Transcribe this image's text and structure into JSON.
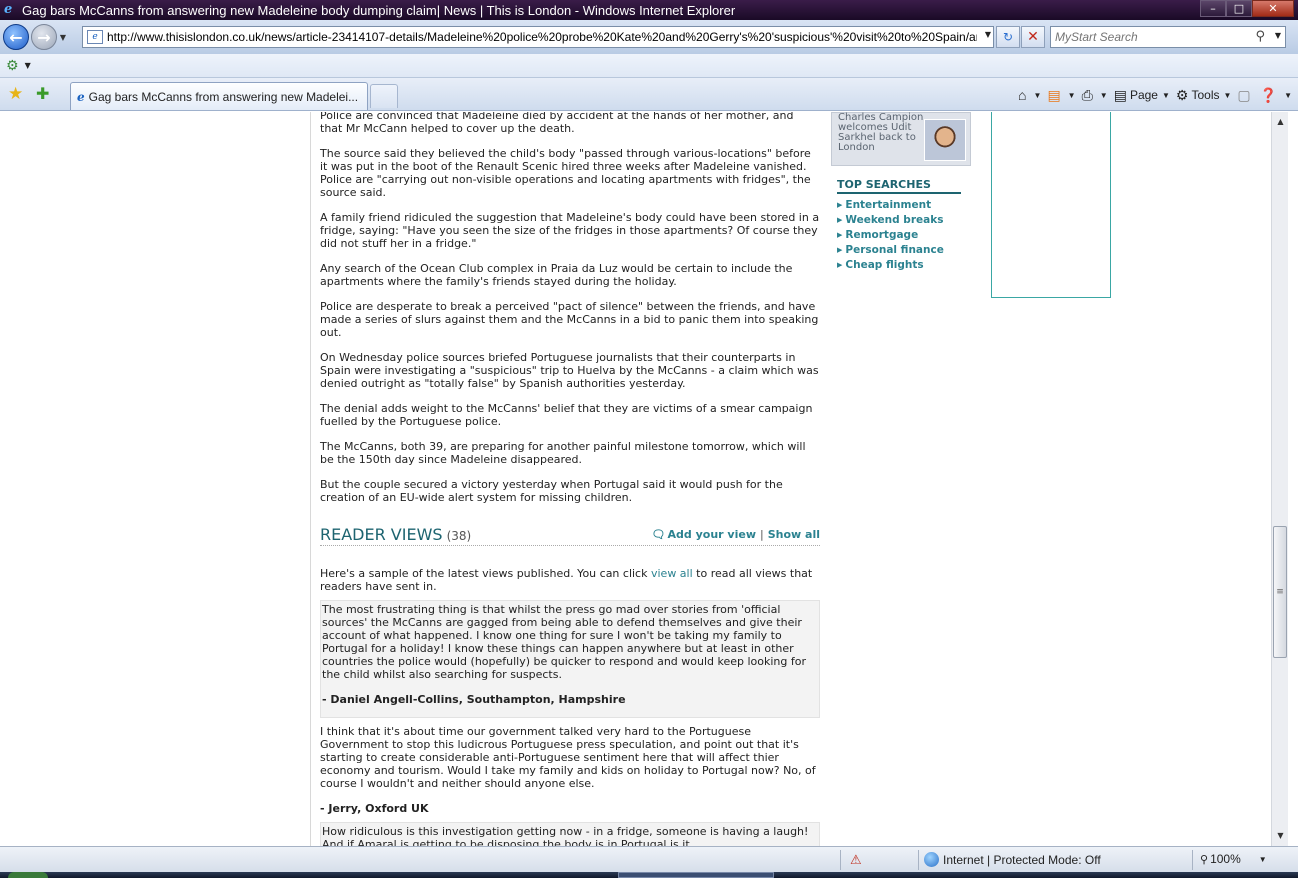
{
  "window": {
    "title": "Gag bars McCanns from answering new Madeleine body dumping claim| News | This is London - Windows Internet Explorer",
    "minimize": "–",
    "maximize": "□",
    "close": "✕"
  },
  "address": {
    "url": "http://www.thisislondon.co.uk/news/article-23414107-details/Madeleine%20police%20probe%20Kate%20and%20Gerry's%20'suspicious'%20visit%20to%20Spain/arti"
  },
  "search": {
    "placeholder": "MyStart Search"
  },
  "tabs": {
    "active_label": "Gag bars McCanns from answering new Madelei..."
  },
  "command_bar": {
    "page_label": "Page",
    "tools_label": "Tools"
  },
  "article": {
    "cut_line": "Police are convinced that Madeleine died by accident at the hands of her mother, and",
    "paragraphs": [
      "that Mr McCann helped to cover up the death.",
      "The source said they believed the child's body \"passed through various-locations\" before it was put in the boot of the Renault Scenic hired three weeks after Madeleine vanished. Police are \"carrying out non-visible operations and locating apartments with fridges\", the source said.",
      "A family friend ridiculed the suggestion that Madeleine's body could have been stored in a fridge, saying: \"Have you seen the size of the fridges in those apartments? Of course they did not stuff her in a fridge.\"",
      "Any search of the Ocean Club complex in Praia da Luz would be certain to include the apartments where the family's friends stayed during the holiday.",
      "Police are desperate to break a perceived \"pact of silence\" between the friends, and have made a series of slurs against them and the McCanns in a bid to panic them into speaking out.",
      "On Wednesday police sources briefed Portuguese journalists that their counterparts in Spain were investigating a \"suspicious\" trip to Huelva by the McCanns - a claim which was denied outright as \"totally false\" by Spanish authorities yesterday.",
      "The denial adds weight to the McCanns' belief that they are victims of a smear campaign fuelled by the Portuguese police.",
      "The McCanns, both 39, are preparing for another painful milestone tomorrow, which will be the 150th day since Madeleine disappeared.",
      "But the couple secured a victory yesterday when Portugal said it would push for the creation of an EU-wide alert system for missing children."
    ]
  },
  "reader_views": {
    "title": "READER VIEWS",
    "count": "(38)",
    "add_view": "Add your view",
    "separator": "|",
    "show_all": "Show all",
    "intro_before": "Here's a sample of the latest views published. You can click ",
    "intro_link": "view all",
    "intro_after": " to read all views that readers have sent in.",
    "comments": [
      {
        "text": "The most frustrating thing is that whilst the press go mad over stories from 'official sources' the McCanns are gagged from being able to defend themselves and give their account of what happened. I know one thing for sure I won't be taking my family to Portugal for a holiday! I know these things can happen anywhere but at least in other countries the police would (hopefully) be quicker to respond and would keep looking for the child whilst also searching for suspects.",
        "author": "- Daniel Angell-Collins, Southampton, Hampshire"
      },
      {
        "text": "I think that it's about time our government talked very hard to the Portuguese Government to stop this ludicrous Portuguese press speculation, and point out that it's starting to create considerable anti-Portuguese sentiment here that will affect thier economy and tourism. Would I take my family and kids on holiday to Portugal now? No, of course I wouldn't and neither should anyone else.",
        "author": "- Jerry, Oxford UK"
      },
      {
        "text": "How ridiculous is this investigation getting now - in a fridge, someone is having a laugh! And if Amaral is getting to be disposing the body is in Portugal is it ..."
      }
    ]
  },
  "sidebar": {
    "promo_text": "Charles Campion welcomes Udit Sarkhel back to London",
    "top_searches_title": "TOP SEARCHES",
    "top_searches": [
      "Entertainment",
      "Weekend breaks",
      "Remortgage",
      "Personal finance",
      "Cheap flights"
    ]
  },
  "status": {
    "zone": "Internet | Protected Mode: Off",
    "zoom": "100%"
  }
}
